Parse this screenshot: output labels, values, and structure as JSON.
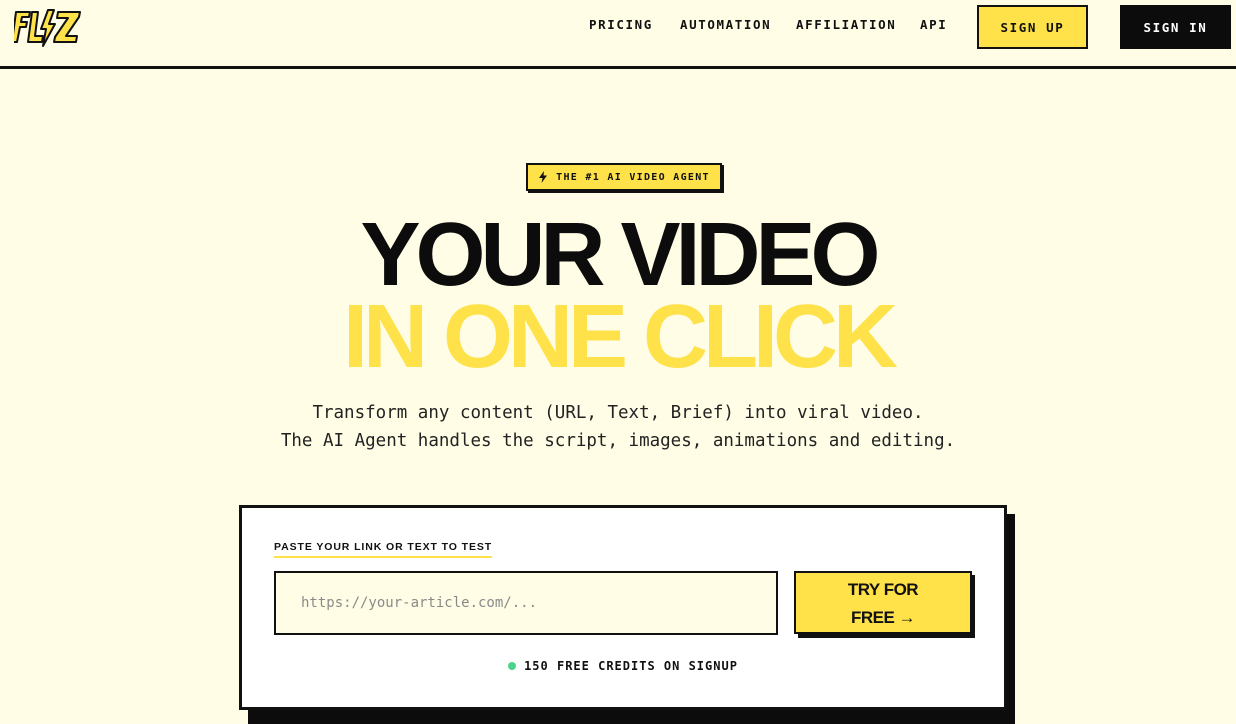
{
  "header": {
    "logo_text": "FLIZ",
    "nav": [
      {
        "label": "PRICING"
      },
      {
        "label": "AUTOMATION"
      },
      {
        "label": "AFFILIATION"
      },
      {
        "label": "API"
      }
    ],
    "signup_label": "SIGN UP",
    "signin_label": "SIGN IN"
  },
  "hero": {
    "badge": "THE #1 AI VIDEO AGENT",
    "title_line1": "YOUR VIDEO",
    "title_line2": "IN ONE CLICK",
    "subtitle_line1": "Transform any content (URL, Text, Brief) into viral video.",
    "subtitle_line2": "The AI Agent handles the script, images, animations and editing."
  },
  "card": {
    "label": "PASTE YOUR LINK OR TEXT TO TEST",
    "input_placeholder": "https://your-article.com/...",
    "input_value": "",
    "cta_line1": "TRY FOR",
    "cta_line2": "FREE →",
    "credits": "150 FREE CREDITS ON SIGNUP"
  },
  "colors": {
    "background": "#fffde6",
    "accent": "#ffe14a",
    "dark": "#0c0c0c",
    "status_dot": "#4cd38a"
  },
  "icons": {
    "logo": "bolt-logo",
    "badge": "lightning-icon",
    "status": "green-dot-icon"
  }
}
